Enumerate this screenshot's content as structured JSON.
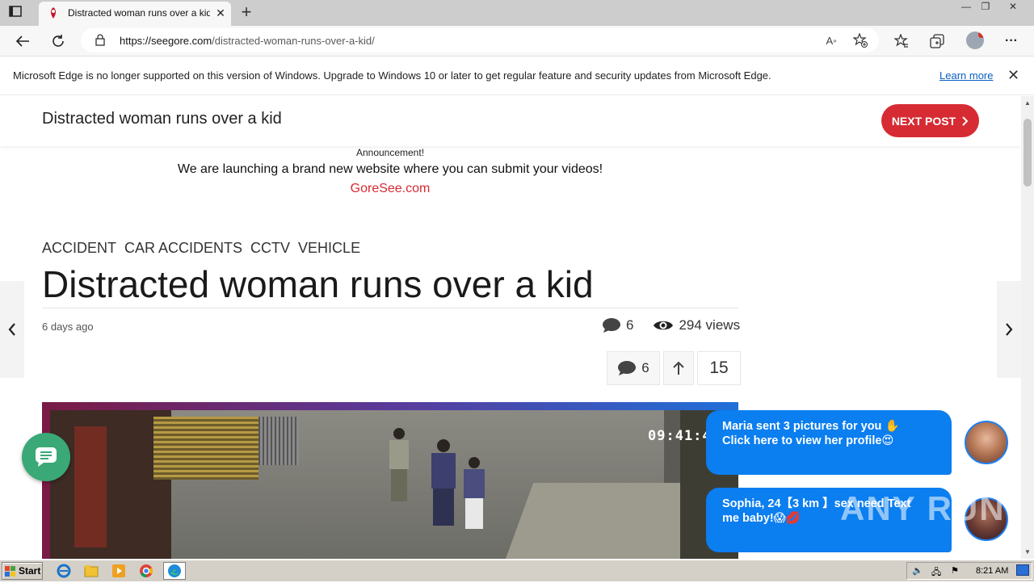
{
  "browser": {
    "tab_title": "Distracted woman runs over a kid",
    "tab_close": "✕",
    "new_tab": "+",
    "window_controls": [
      "—",
      "❐",
      "✕"
    ],
    "url_domain": "https://seegore.com",
    "url_path": "/distracted-woman-runs-over-a-kid/",
    "more_label": "···"
  },
  "infobar": {
    "message": "Microsoft Edge is no longer supported on this version of Windows. Upgrade to Windows 10 or later to get regular feature and security updates from Microsoft Edge.",
    "learn_more": "Learn more",
    "close": "✕"
  },
  "sticky": {
    "title": "Distracted woman runs over a kid",
    "next_post": "NEXT POST"
  },
  "announcement": {
    "heading": "Announcement!",
    "text": "We are launching a brand new website where you can submit your videos!",
    "link": "GoreSee.com"
  },
  "post": {
    "categories": [
      "ACCIDENT",
      "CAR ACCIDENTS",
      "CCTV",
      "VEHICLE"
    ],
    "title": "Distracted woman runs over a kid",
    "date": "6 days ago",
    "comments": "6",
    "views": "294 views",
    "action_comments": "6",
    "votes": "15",
    "video_timestamp": "09:41:4"
  },
  "notifications": [
    {
      "line1": "Maria sent 3 pictures for you ✋",
      "line2": "Click here to view her profile😍"
    },
    {
      "line1": "Sophia, 24【3 km 】sex need Text",
      "line2": "me baby!😱💋"
    }
  ],
  "watermark": "ANY RUN",
  "taskbar": {
    "start": "Start",
    "clock": "8:21 AM"
  },
  "colors": {
    "accent_red": "#d62b33",
    "bubble_blue": "#0b7ef0",
    "chat_green": "#3aa877"
  }
}
